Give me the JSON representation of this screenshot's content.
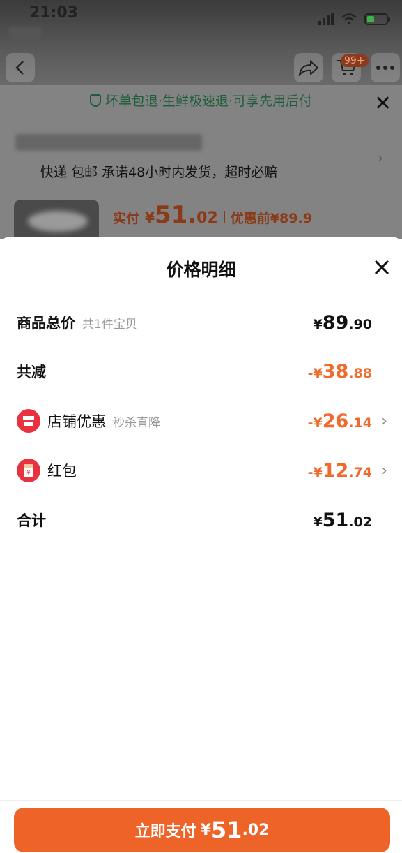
{
  "status_bar": {
    "time": "21:03"
  },
  "header": {
    "cart_badge": "99+"
  },
  "bg": {
    "guarantee": "坏单包退·生鲜极速退·可享先用后付",
    "delivery": "快递 包邮 承诺48小时内发货，超时必赔",
    "price_label": "实付",
    "price_currency": "¥",
    "price_int": "51.",
    "price_dec": "02",
    "before_label": "优惠前",
    "before_price": "¥89.9"
  },
  "sheet": {
    "title": "价格明细",
    "rows": [
      {
        "label": "商品总价",
        "sub": "共1件宝贝",
        "currency": "¥",
        "int": "89",
        "dec": ".90"
      },
      {
        "label": "共减",
        "currency": "-¥",
        "int": "38",
        "dec": ".88"
      },
      {
        "label": "店铺优惠",
        "sub": "秒杀直降",
        "currency": "-¥",
        "int": "26",
        "dec": ".14"
      },
      {
        "label": "红包",
        "currency": "-¥",
        "int": "12",
        "dec": ".74"
      },
      {
        "label": "合计",
        "currency": "¥",
        "int": "51",
        "dec": ".02"
      }
    ],
    "pay_button": {
      "label": "立即支付",
      "currency": "¥",
      "int": "51",
      "dec": ".02"
    }
  },
  "colors": {
    "accent": "#ee6328",
    "discount": "#ef6a2c",
    "store_icon": "#e8323f"
  },
  "icons": [
    "back-icon",
    "share-icon",
    "cart-icon",
    "more-icon",
    "shield-icon",
    "close-icon",
    "store-icon",
    "red-packet-icon",
    "chevron-right-icon"
  ]
}
